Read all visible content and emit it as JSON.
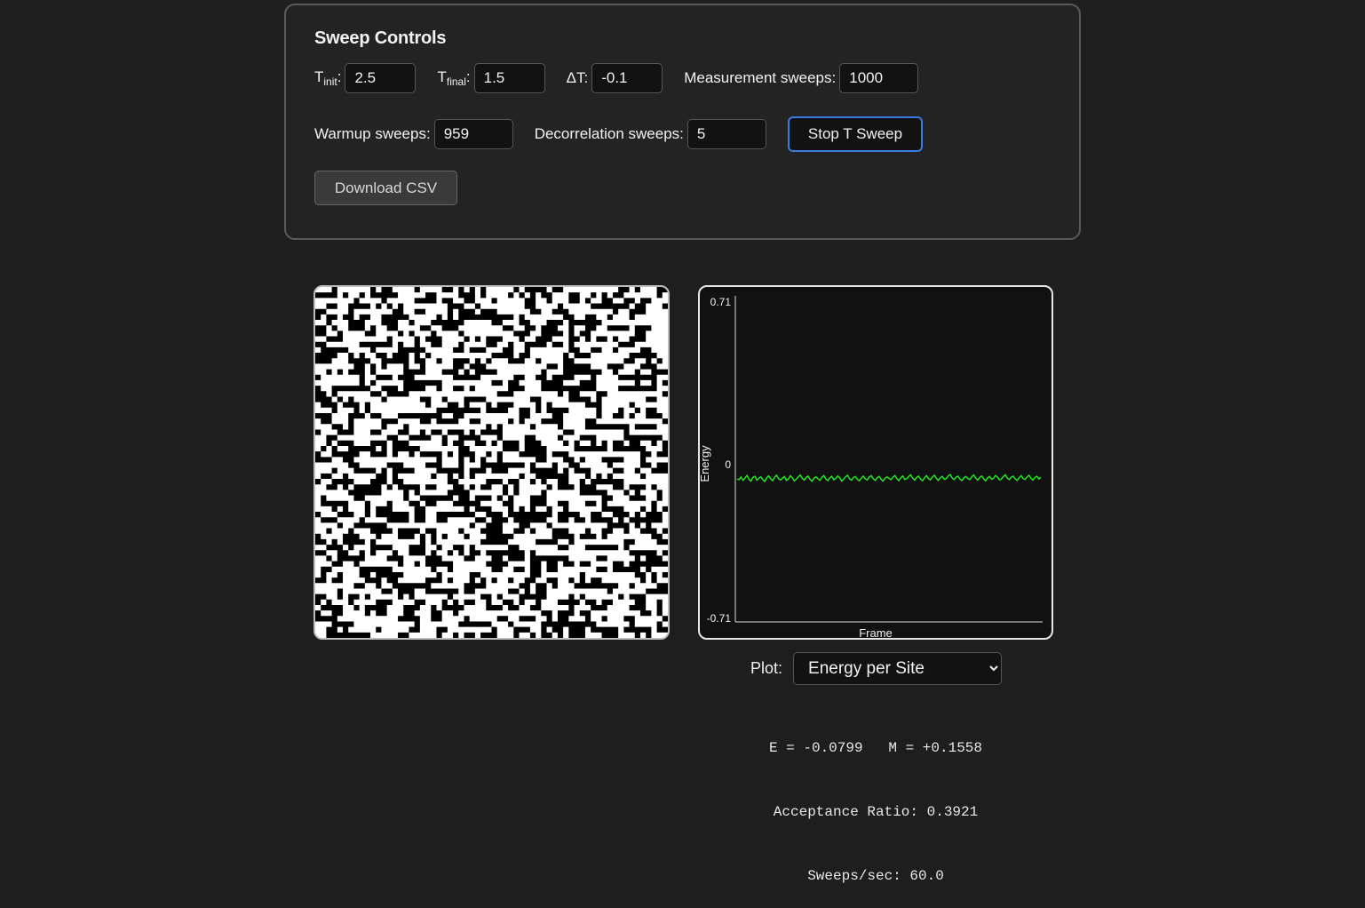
{
  "sweep_controls": {
    "title": "Sweep Controls",
    "t_init": {
      "label_main": "T",
      "label_sub": "init",
      "label_suffix": ":",
      "value": "2.5"
    },
    "t_final": {
      "label_main": "T",
      "label_sub": "final",
      "label_suffix": ":",
      "value": "1.5"
    },
    "delta_t": {
      "label": "ΔT:",
      "value": "-0.1"
    },
    "measurement_sweeps": {
      "label": "Measurement sweeps:",
      "value": "1000"
    },
    "warmup_sweeps": {
      "label": "Warmup sweeps:",
      "value": "959"
    },
    "decorrelation_sweeps": {
      "label": "Decorrelation sweeps:",
      "value": "5"
    },
    "stop_button_label": "Stop T Sweep",
    "download_button_label": "Download CSV"
  },
  "lattice": {
    "size": 64,
    "up_color": "#ffffff",
    "down_color": "#000000",
    "seed": 20240607,
    "down_fraction": 0.42
  },
  "plot_selector": {
    "label": "Plot:",
    "selected": "Energy per Site",
    "options": [
      "Energy per Site"
    ]
  },
  "stats": {
    "energy_line": "E = -0.0799   M = +0.1558",
    "acceptance_line": "Acceptance Ratio: 0.3921",
    "sweeps_line": "Sweeps/sec: 60.0"
  },
  "chart_data": {
    "type": "line",
    "title": "",
    "xlabel": "Frame",
    "ylabel": "Energy",
    "ylim": [
      -0.71,
      0.71
    ],
    "yticks": [
      "0.71",
      "0",
      "-0.71"
    ],
    "grid": false,
    "line_color": "#22ee22",
    "series": [
      {
        "values": [
          -0.088,
          -0.091,
          -0.079,
          -0.094,
          -0.083,
          -0.072,
          -0.089,
          -0.097,
          -0.081,
          -0.076,
          -0.093,
          -0.085,
          -0.078,
          -0.09,
          -0.099,
          -0.082,
          -0.074,
          -0.087,
          -0.095,
          -0.08,
          -0.071,
          -0.086,
          -0.092,
          -0.084,
          -0.077,
          -0.094,
          -0.088,
          -0.073,
          -0.083,
          -0.096,
          -0.089,
          -0.079,
          -0.07,
          -0.085,
          -0.093,
          -0.081,
          -0.075,
          -0.09,
          -0.098,
          -0.084,
          -0.078,
          -0.087,
          -0.094,
          -0.08,
          -0.072,
          -0.088,
          -0.095,
          -0.083,
          -0.076,
          -0.091,
          -0.086,
          -0.074,
          -0.082,
          -0.097,
          -0.089,
          -0.078,
          -0.071,
          -0.087,
          -0.093,
          -0.081,
          -0.077,
          -0.09,
          -0.096,
          -0.083,
          -0.075,
          -0.088,
          -0.092,
          -0.079,
          -0.073,
          -0.086,
          -0.094,
          -0.082,
          -0.076,
          -0.089,
          -0.097,
          -0.084,
          -0.078,
          -0.085,
          -0.091,
          -0.08,
          -0.072,
          -0.087,
          -0.095,
          -0.083,
          -0.074,
          -0.09,
          -0.086,
          -0.077,
          -0.069,
          -0.084,
          -0.093,
          -0.081,
          -0.075,
          -0.088,
          -0.096,
          -0.082,
          -0.073,
          -0.086,
          -0.092,
          -0.079,
          -0.071,
          -0.085,
          -0.094,
          -0.083,
          -0.076,
          -0.089,
          -0.087,
          -0.074,
          -0.068,
          -0.083,
          -0.091,
          -0.08,
          -0.075,
          -0.088,
          -0.095,
          -0.082,
          -0.077,
          -0.086,
          -0.09,
          -0.078,
          -0.07,
          -0.084,
          -0.093,
          -0.081,
          -0.074,
          -0.087,
          -0.096,
          -0.083,
          -0.076,
          -0.089,
          -0.085,
          -0.072,
          -0.079,
          -0.092,
          -0.088,
          -0.077,
          -0.069,
          -0.084,
          -0.091,
          -0.08,
          -0.075,
          -0.087,
          -0.094,
          -0.082,
          -0.073,
          -0.086,
          -0.09,
          -0.079,
          -0.071,
          -0.085,
          -0.093,
          -0.081,
          -0.076,
          -0.088,
          -0.0799
        ]
      }
    ]
  }
}
